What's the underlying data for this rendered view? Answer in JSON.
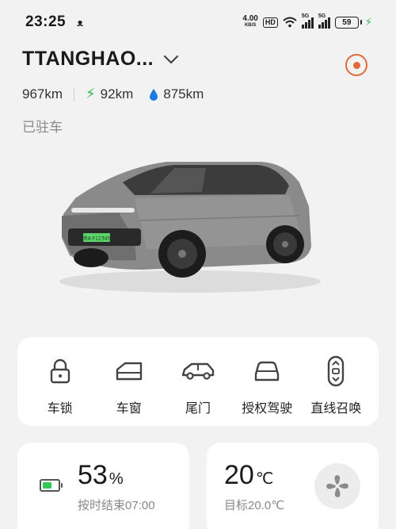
{
  "status_bar": {
    "time": "23:25",
    "app_glyph": "ᴥ",
    "net_speed_value": "4.00",
    "net_speed_unit": "KB/S",
    "hd_label": "HD",
    "signal1_tag": "5G",
    "signal2_tag": "5G",
    "battery_level": "59"
  },
  "vehicle": {
    "name": "TTANGHAO...",
    "electric_range": "92km",
    "total_range": "967km",
    "fuel_range": "875km",
    "status": "已驻车",
    "plate": "京A·F12345"
  },
  "controls": [
    {
      "label": "车锁",
      "icon": "lock-icon"
    },
    {
      "label": "车窗",
      "icon": "window-icon"
    },
    {
      "label": "尾门",
      "icon": "tailgate-icon"
    },
    {
      "label": "授权驾驶",
      "icon": "authorized-driving-icon"
    },
    {
      "label": "直线召唤",
      "icon": "straight-summon-icon"
    }
  ],
  "battery_card": {
    "percent": "53",
    "unit": "%",
    "subtitle": "按时结束07:00"
  },
  "climate_card": {
    "temperature": "20",
    "unit": "℃",
    "subtitle": "目标20.0℃"
  },
  "colors": {
    "accent_orange": "#e06a3a",
    "charge_green": "#2fb54a",
    "fuel_blue": "#1a7be0"
  }
}
